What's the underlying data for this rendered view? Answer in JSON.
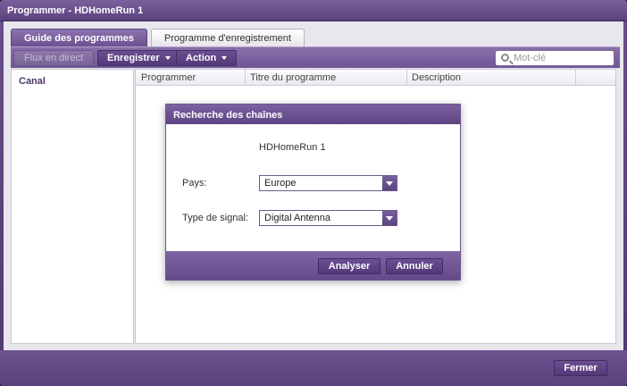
{
  "window": {
    "title": "Programmer - HDHomeRun 1"
  },
  "tabs": [
    {
      "label": "Guide des programmes",
      "active": true
    },
    {
      "label": "Programme d'enregistrement",
      "active": false
    }
  ],
  "toolbar": {
    "live_label": "Flux en direct",
    "record_label": "Enregistrer",
    "action_label": "Action",
    "search_placeholder": "Mot-clé"
  },
  "left_pane": {
    "label": "Canal"
  },
  "grid": {
    "columns": [
      "Programmer",
      "Titre du programme",
      "Description"
    ]
  },
  "dialog": {
    "title": "Recherche des chaînes",
    "device_name": "HDHomeRun 1",
    "country_label": "Pays:",
    "country_value": "Europe",
    "signal_label": "Type de signal:",
    "signal_value": "Digital Antenna",
    "scan_label": "Analyser",
    "cancel_label": "Annuler"
  },
  "footer": {
    "close_label": "Fermer"
  },
  "colors": {
    "accent": "#6a4f8f",
    "accent_dark": "#533978"
  }
}
